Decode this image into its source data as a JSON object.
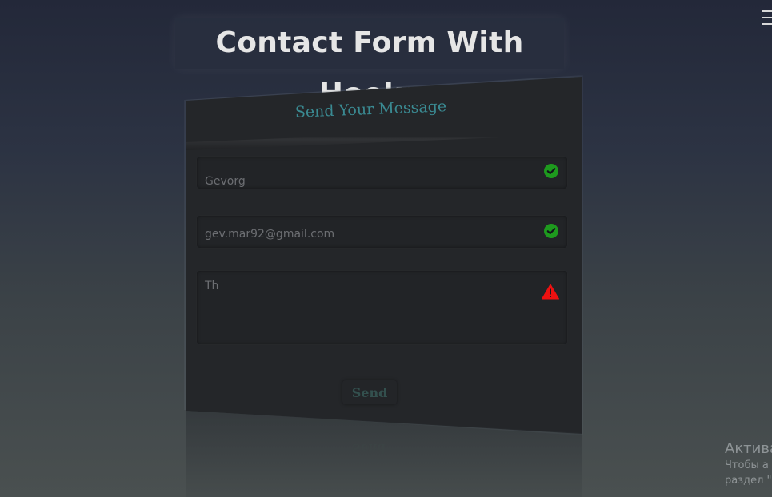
{
  "page": {
    "title": "Contact Form With Hooks"
  },
  "form": {
    "heading": "Send Your Message",
    "fields": {
      "name": {
        "value": "Gevorg",
        "status": "valid"
      },
      "email": {
        "value": "gev.mar92@gmail.com",
        "status": "valid"
      },
      "message": {
        "value": "Th",
        "status": "error"
      }
    },
    "send_label": "Send"
  },
  "watermark": {
    "title": "Актива",
    "line1": "Чтобы а",
    "line2": "раздел \""
  },
  "colors": {
    "valid": "#1e9a1e",
    "error": "#ee1111",
    "accent": "#3a8a92"
  },
  "icons": {
    "menu": "hamburger-menu-icon",
    "valid": "check-circle-icon",
    "error": "warning-triangle-icon"
  }
}
